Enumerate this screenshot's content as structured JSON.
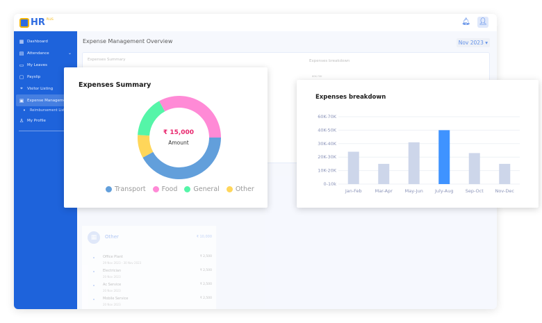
{
  "app": {
    "logo_text": "HR",
    "logo_badge": "PLUS"
  },
  "header": {
    "bell_icon": "bell-icon",
    "avatar_icon": "user-icon"
  },
  "sidebar": {
    "items": [
      {
        "label": "Dashboard",
        "icon": "grid-icon"
      },
      {
        "label": "Attendance",
        "icon": "clipboard-icon"
      },
      {
        "label": "My Leaves",
        "icon": "calendar-icon"
      },
      {
        "label": "Payslip",
        "icon": "document-icon"
      },
      {
        "label": "Visitor Listing",
        "icon": "location-icon"
      },
      {
        "label": "Expense Management",
        "icon": "receipt-icon"
      },
      {
        "label": "Reimbursement List",
        "icon": "dot-icon"
      },
      {
        "label": "My Profile",
        "icon": "user-icon"
      }
    ]
  },
  "main": {
    "title": "Expense Management Overview",
    "month": "Nov 2023",
    "bg_summary_label": "Expenses Summary",
    "bg_breakdown_label": "Expenses breakdown",
    "bg_tick": "60K-70K",
    "other_group": {
      "title": "Other",
      "total": "₹ 10,000",
      "items": [
        {
          "name": "Office Plant",
          "date": "29 Nov 2023 - 30 Nov 2023",
          "amount": "₹ 2,500"
        },
        {
          "name": "Electrician",
          "date": "20 Nov 2023",
          "amount": "₹ 2,500"
        },
        {
          "name": "Ac Service",
          "date": "20 Nov 2023",
          "amount": "₹ 2,500"
        },
        {
          "name": "Mobile Service",
          "date": "20 Nov 2023",
          "amount": "₹ 2,500"
        }
      ]
    }
  },
  "chart_data": [
    {
      "type": "pie",
      "title": "Expenses Summary",
      "center_value": "₹ 15,000",
      "center_label": "Amount",
      "categories": [
        "Transport",
        "Food",
        "General",
        "Other"
      ],
      "values": [
        42,
        33,
        16,
        9
      ],
      "colors": [
        "#629fdb",
        "#ff8ad6",
        "#55f5a8",
        "#ffd65a"
      ],
      "legend": "bottom"
    },
    {
      "type": "bar",
      "title": "Expenses breakdown",
      "categories": [
        "Jan-Feb",
        "Mar-Apr",
        "May-Jun",
        "July-Aug",
        "Sep-Oct",
        "Nov-Dec"
      ],
      "values": [
        24,
        15,
        31,
        40,
        23,
        15
      ],
      "yticks": [
        "0-10k",
        "10K-20K",
        "20K-30K",
        "30K-40K",
        "40K-50K",
        "60K-70K"
      ],
      "ylim": [
        0,
        50
      ],
      "grid": true,
      "highlight": "July-Aug",
      "colors": {
        "bar": "#cdd6ea",
        "highlight": "#3f93ff"
      }
    }
  ]
}
